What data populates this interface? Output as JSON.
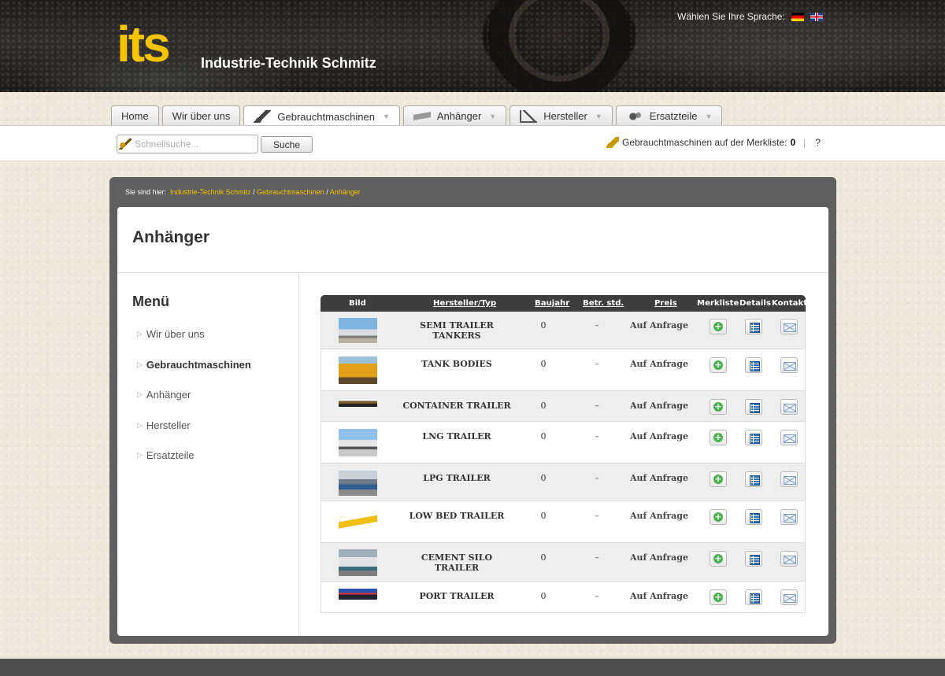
{
  "header": {
    "logo_mark": "its",
    "logo_text": "Industrie-Technik Schmitz",
    "language_label": "Wählen Sie Ihre Sprache:"
  },
  "tabs": [
    {
      "label": "Home",
      "icon": "none"
    },
    {
      "label": "Wir über uns",
      "icon": "none"
    },
    {
      "label": "Gebrauchtmaschinen",
      "icon": "excavator-icon",
      "active": true
    },
    {
      "label": "Anhänger",
      "icon": "trailer-icon"
    },
    {
      "label": "Hersteller",
      "icon": "crane-icon"
    },
    {
      "label": "Ersatzteile",
      "icon": "parts-icon"
    }
  ],
  "search": {
    "placeholder": "Schnellsuche...",
    "button_label": "Suche",
    "merkliste_label": "Gebrauchtmaschinen auf der Merkliste:",
    "merkliste_count": "0",
    "help": "?"
  },
  "breadcrumb": {
    "prefix": "Sie sind hier:",
    "items": [
      "Industrie-Technik Schmitz",
      "Gebrauchtmaschinen",
      "Anhänger"
    ],
    "separator": "/"
  },
  "page_title": "Anhänger",
  "sidebar": {
    "title": "Menü",
    "items": [
      {
        "label": "Wir über uns",
        "bold": false
      },
      {
        "label": "Gebrauchtmaschinen",
        "bold": true
      },
      {
        "label": "Anhänger",
        "bold": false
      },
      {
        "label": "Hersteller",
        "bold": false
      },
      {
        "label": "Ersatzteile",
        "bold": false
      }
    ]
  },
  "table": {
    "headers": [
      "Bild",
      "Hersteller/Typ",
      "Baujahr",
      "Betr. std.",
      "Preis",
      "Merkliste",
      "Details",
      "Kontakt"
    ],
    "rows": [
      {
        "name": "SEMI TRAILER TANKERS",
        "year": "0",
        "hours": "–",
        "price": "Auf Anfrage"
      },
      {
        "name": "TANK BODIES",
        "year": "0",
        "hours": "–",
        "price": "Auf Anfrage"
      },
      {
        "name": "CONTAINER TRAILER",
        "year": "0",
        "hours": "–",
        "price": "Auf Anfrage"
      },
      {
        "name": "LNG TRAILER",
        "year": "0",
        "hours": "–",
        "price": "Auf Anfrage"
      },
      {
        "name": "LPG TRAILER",
        "year": "0",
        "hours": "–",
        "price": "Auf Anfrage"
      },
      {
        "name": "LOW BED TRAILER",
        "year": "0",
        "hours": "–",
        "price": "Auf Anfrage"
      },
      {
        "name": "CEMENT SILO TRAILER",
        "year": "0",
        "hours": "–",
        "price": "Auf Anfrage"
      },
      {
        "name": "PORT TRAILER",
        "year": "0",
        "hours": "–",
        "price": "Auf Anfrage"
      }
    ]
  },
  "colors": {
    "accent": "#f6c400",
    "frame": "#5f5f5f",
    "table_header": "#3d3d3d"
  }
}
